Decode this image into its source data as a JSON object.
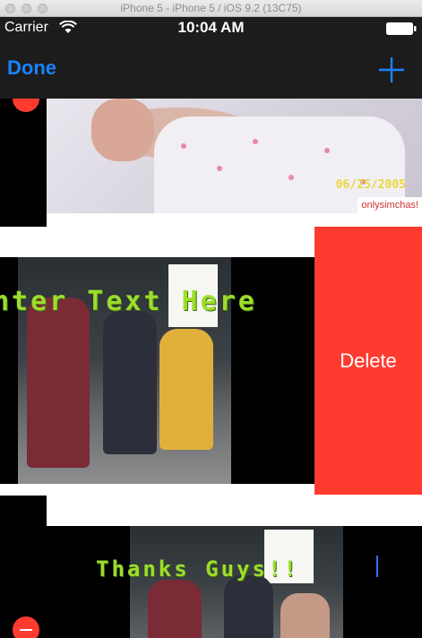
{
  "simulator": {
    "title": "iPhone 5 - iPhone 5 / iOS 9.2 (13C75)"
  },
  "status_bar": {
    "carrier": "Carrier",
    "time": "10:04 AM"
  },
  "nav": {
    "done_label": "Done",
    "add_icon": "plus-icon"
  },
  "rows": [
    {
      "date_stamp": "06/25/2005",
      "watermark": "onlysimchas!"
    },
    {
      "overlay_text": "nter Text Here",
      "delete_label": "Delete"
    },
    {
      "overlay_text": "Thanks Guys!!"
    }
  ],
  "colors": {
    "accent": "#1a82ff",
    "delete": "#ff3b30",
    "overlay_text": "#9cdd2c"
  }
}
